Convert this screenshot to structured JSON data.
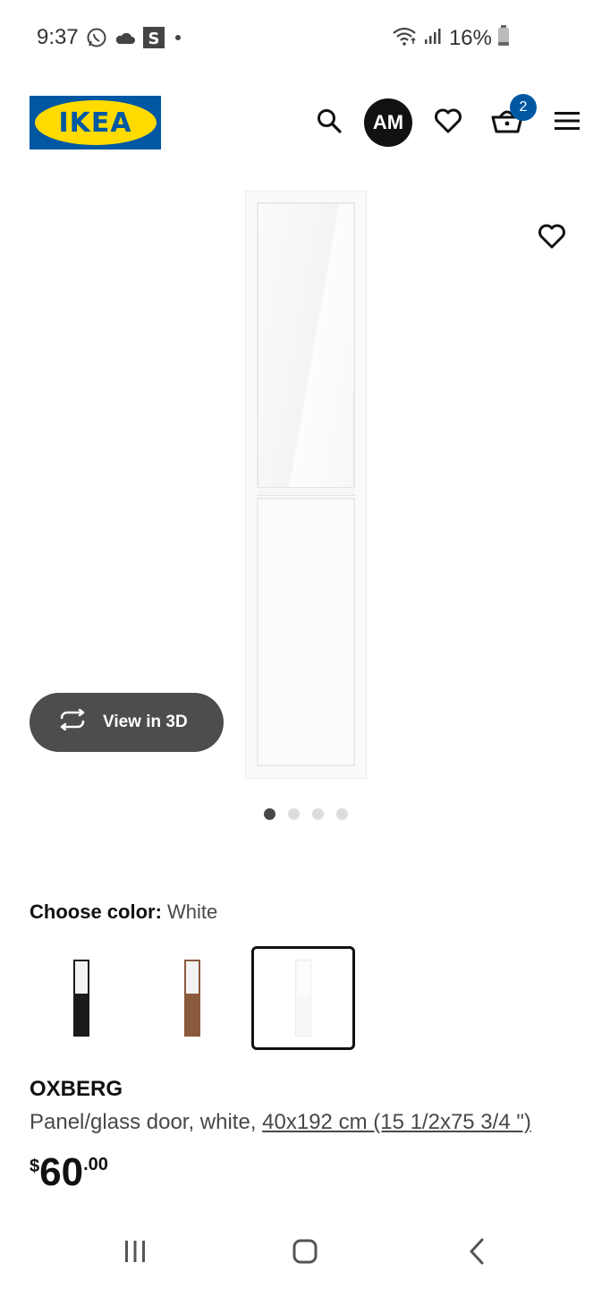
{
  "status_bar": {
    "time": "9:37",
    "battery": "16%",
    "icons": [
      "whatsapp-icon",
      "cloud-icon",
      "s-app-icon",
      "dot-icon",
      "wifi-icon",
      "signal-icon",
      "battery-icon"
    ]
  },
  "header": {
    "logo_text": "IKEA",
    "avatar_initials": "AM",
    "cart_count": "2",
    "brand_blue": "#0058a3",
    "brand_yellow": "#ffdb00"
  },
  "gallery": {
    "view_3d_label": "View in 3D",
    "image_count": 4,
    "active_index": 0
  },
  "color_chooser": {
    "label": "Choose color:",
    "selected": "White",
    "options": [
      {
        "name": "black",
        "color": "#1a1a1a"
      },
      {
        "name": "brown",
        "color": "#8a5a3c"
      },
      {
        "name": "white",
        "color": "#f7f7f7"
      }
    ]
  },
  "product": {
    "name": "OXBERG",
    "description": "Panel/glass door, white, ",
    "dimensions": "40x192 cm (15 1/2x75 3/4 \")",
    "price_currency": "$",
    "price_integer": "60",
    "price_decimal": ".00"
  },
  "nav_bar": {
    "icons": [
      "recent-apps-icon",
      "home-icon",
      "back-icon"
    ]
  }
}
